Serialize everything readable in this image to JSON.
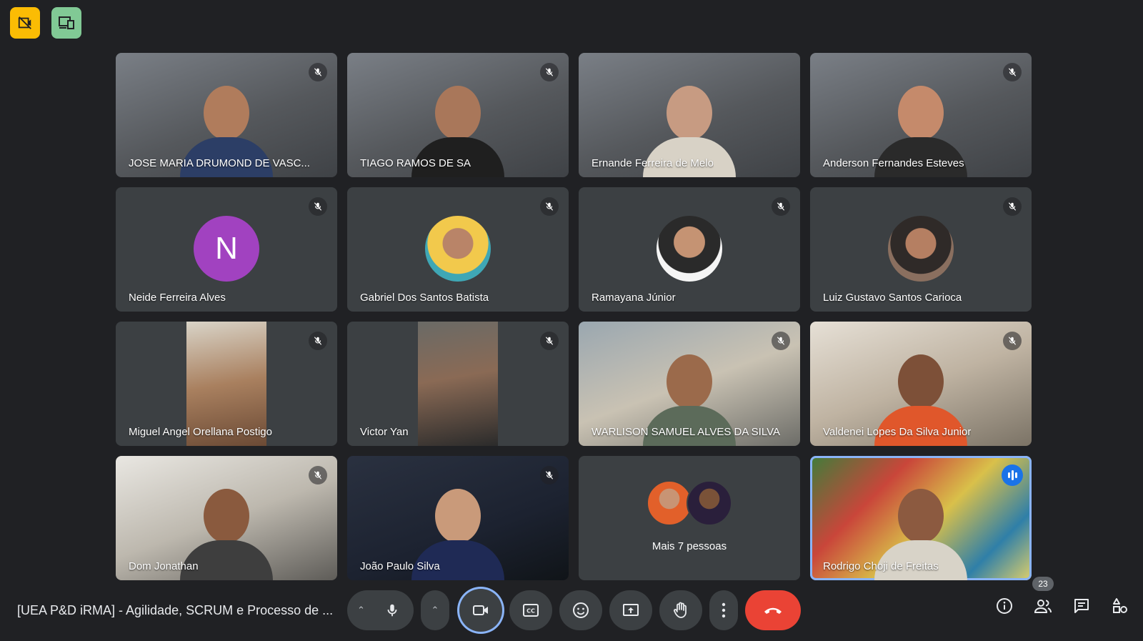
{
  "colors": {
    "background": "#202124",
    "tile": "#3c4043",
    "active_outline": "#8ab4f8",
    "end_call": "#ea4335",
    "recording_badge": "#fbbc04",
    "companion_badge": "#81c995",
    "avatar_letter_bg": "#a142c0"
  },
  "participants": [
    {
      "name": "JOSE MARIA DRUMOND DE VASC...",
      "type": "video",
      "muted": true
    },
    {
      "name": "TIAGO RAMOS DE SA",
      "type": "video",
      "muted": true
    },
    {
      "name": "Ernande Ferreira de Melo",
      "type": "video",
      "muted": false
    },
    {
      "name": "Anderson Fernandes Esteves",
      "type": "video",
      "muted": true
    },
    {
      "name": "Neide Ferreira Alves",
      "type": "avatar-letter",
      "letter": "N",
      "muted": true
    },
    {
      "name": "Gabriel Dos Santos Batista",
      "type": "avatar-photo",
      "muted": true
    },
    {
      "name": "Ramayana Júnior",
      "type": "avatar-photo",
      "muted": true
    },
    {
      "name": "Luiz Gustavo Santos Carioca",
      "type": "avatar-photo",
      "muted": true
    },
    {
      "name": "Miguel Angel Orellana Postigo",
      "type": "portrait-video",
      "muted": true
    },
    {
      "name": "Victor Yan",
      "type": "portrait-video",
      "muted": true
    },
    {
      "name": "WARLISON SAMUEL ALVES DA SILVA",
      "type": "video",
      "muted": true
    },
    {
      "name": "Valdenei Lopes Da Silva Junior",
      "type": "video",
      "muted": true
    },
    {
      "name": "Dom Jonathan",
      "type": "video",
      "muted": true
    },
    {
      "name": "João Paulo Silva",
      "type": "video",
      "muted": true
    }
  ],
  "more_tile": {
    "label": "Mais 7 pessoas"
  },
  "active_speaker": {
    "name": "Rodrigo Choji de Freitas",
    "speaking": true
  },
  "meeting": {
    "title": "[UEA P&D iRMA] - Agilidade, SCRUM e Processo de ..."
  },
  "toolbar": {
    "icons": [
      "caret-up-icon",
      "mic-icon",
      "caret-up-icon",
      "camera-icon",
      "captions-icon",
      "emoji-icon",
      "present-icon",
      "raise-hand-icon",
      "more-options-icon",
      "end-call-icon"
    ]
  },
  "right_tools": {
    "people_count": "23",
    "icons": [
      "info-icon",
      "people-icon",
      "chat-icon",
      "activities-icon"
    ]
  }
}
